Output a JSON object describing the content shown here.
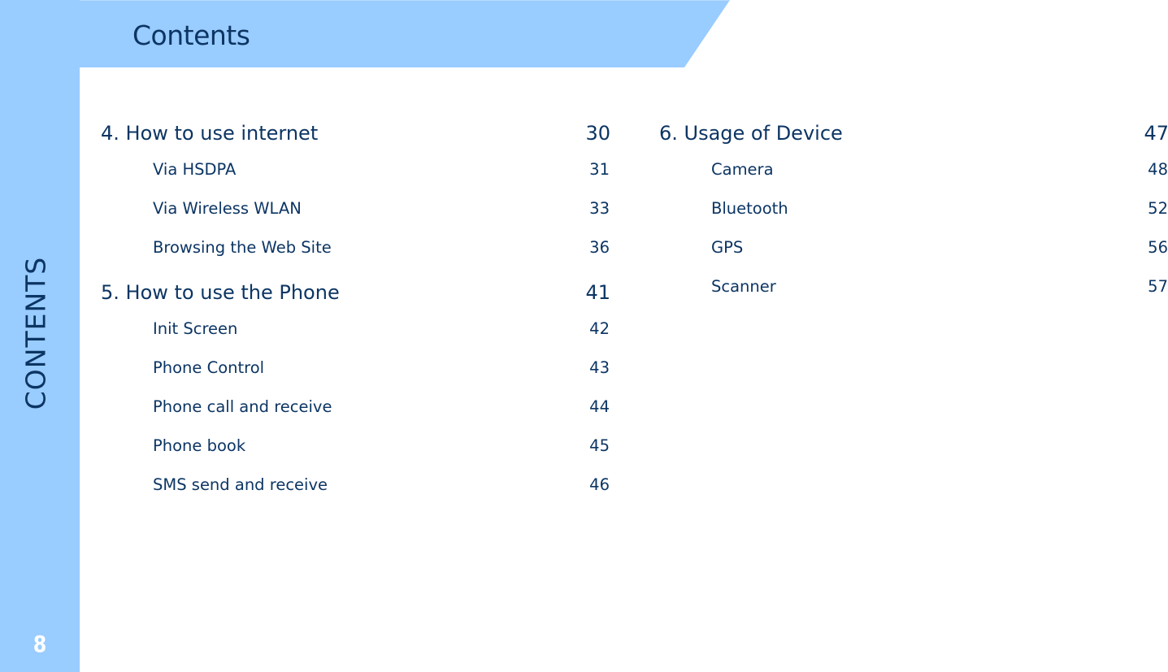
{
  "header": {
    "title": "Contents"
  },
  "sidebar": {
    "label": "CONTENTS",
    "page_number": "8"
  },
  "colors": {
    "band": "#99ccff",
    "text": "#0c3563",
    "page_number": "#ffffff",
    "background": "#ffffff"
  },
  "toc": {
    "left": [
      {
        "title": "4. How to use internet",
        "page": "30",
        "items": [
          {
            "title": "Via HSDPA",
            "page": "31"
          },
          {
            "title": "Via Wireless WLAN",
            "page": "33"
          },
          {
            "title": "Browsing the Web Site",
            "page": "36"
          }
        ]
      },
      {
        "title": "5. How to use the Phone",
        "page": "41",
        "items": [
          {
            "title": "Init Screen",
            "page": "42"
          },
          {
            "title": "Phone Control",
            "page": "43"
          },
          {
            "title": "Phone call and receive",
            "page": "44"
          },
          {
            "title": "Phone book",
            "page": "45"
          },
          {
            "title": "SMS send and receive",
            "page": "46"
          }
        ]
      }
    ],
    "right": [
      {
        "title": "6. Usage of Device",
        "page": "47",
        "items": [
          {
            "title": "Camera",
            "page": "48"
          },
          {
            "title": "Bluetooth",
            "page": "52"
          },
          {
            "title": "GPS",
            "page": "56"
          },
          {
            "title": "Scanner",
            "page": "57"
          }
        ]
      }
    ]
  }
}
